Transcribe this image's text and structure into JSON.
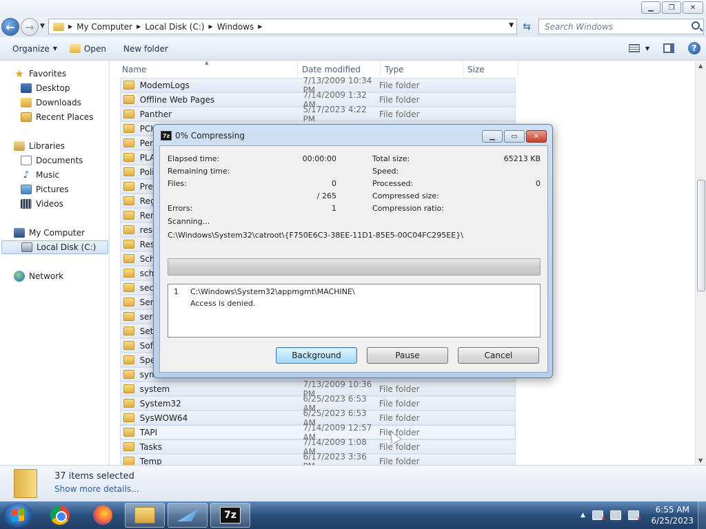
{
  "window": {
    "caption_buttons": [
      "minimize",
      "maximize",
      "close"
    ]
  },
  "address": {
    "crumbs": [
      "My Computer",
      "Local Disk (C:)",
      "Windows"
    ],
    "search_placeholder": "Search Windows"
  },
  "toolbar": {
    "organize": "Organize",
    "open": "Open",
    "new_folder": "New folder"
  },
  "nav": {
    "favorites": "Favorites",
    "desktop": "Desktop",
    "downloads": "Downloads",
    "recent_places": "Recent Places",
    "libraries": "Libraries",
    "documents": "Documents",
    "music": "Music",
    "pictures": "Pictures",
    "videos": "Videos",
    "my_computer": "My Computer",
    "local_disk": "Local Disk (C:)",
    "network": "Network"
  },
  "columns": {
    "name": "Name",
    "date": "Date modified",
    "type": "Type",
    "size": "Size"
  },
  "files": [
    {
      "name": "ModemLogs",
      "date": "7/13/2009 10:34 PM",
      "type": "File folder"
    },
    {
      "name": "Offline Web Pages",
      "date": "7/14/2009 1:32 AM",
      "type": "File folder"
    },
    {
      "name": "Panther",
      "date": "5/17/2023 4:22 PM",
      "type": "File folder"
    },
    {
      "name": "PCH",
      "date": "",
      "type": ""
    },
    {
      "name": "Perfo",
      "date": "",
      "type": ""
    },
    {
      "name": "PLA",
      "date": "",
      "type": ""
    },
    {
      "name": "Polic",
      "date": "",
      "type": ""
    },
    {
      "name": "Prefe",
      "date": "",
      "type": ""
    },
    {
      "name": "Regi",
      "date": "",
      "type": ""
    },
    {
      "name": "Rem",
      "date": "",
      "type": ""
    },
    {
      "name": "resca",
      "date": "",
      "type": ""
    },
    {
      "name": "Reso",
      "date": "",
      "type": ""
    },
    {
      "name": "SchC",
      "date": "",
      "type": ""
    },
    {
      "name": "sche",
      "date": "",
      "type": ""
    },
    {
      "name": "secu",
      "date": "",
      "type": ""
    },
    {
      "name": "Servi",
      "date": "",
      "type": ""
    },
    {
      "name": "servi",
      "date": "",
      "type": ""
    },
    {
      "name": "Setu",
      "date": "",
      "type": ""
    },
    {
      "name": "Softv",
      "date": "",
      "type": ""
    },
    {
      "name": "Spee",
      "date": "",
      "type": ""
    },
    {
      "name": "syml",
      "date": "",
      "type": ""
    },
    {
      "name": "system",
      "date": "7/13/2009 10:36 PM",
      "type": "File folder"
    },
    {
      "name": "System32",
      "date": "6/25/2023 6:53 AM",
      "type": "File folder"
    },
    {
      "name": "SysWOW64",
      "date": "6/25/2023 6:53 AM",
      "type": "File folder"
    },
    {
      "name": "TAPI",
      "date": "7/14/2009 12:57 AM",
      "type": "File folder"
    },
    {
      "name": "Tasks",
      "date": "7/14/2009 1:08 AM",
      "type": "File folder"
    },
    {
      "name": "Temp",
      "date": "6/17/2023 3:36 PM",
      "type": "File folder"
    }
  ],
  "details": {
    "count": "37 items selected",
    "more": "Show more details..."
  },
  "dialog": {
    "title": "0% Compressing",
    "icon_text": "7z",
    "progress": 0,
    "labels": {
      "elapsed": "Elapsed time:",
      "remaining": "Remaining time:",
      "files": "Files:",
      "errors": "Errors:",
      "scanning": "Scanning...",
      "total_size": "Total size:",
      "speed": "Speed:",
      "processed": "Processed:",
      "compressed_size": "Compressed size:",
      "compression_ratio": "Compression ratio:"
    },
    "values": {
      "elapsed": "00:00:00",
      "files": "0",
      "files_total": "/ 265",
      "errors": "1",
      "total_size": "65213 KB",
      "processed": "0"
    },
    "current_path": "C:\\Windows\\System32\\catroot\\{F750E6C3-38EE-11D1-85E5-00C04FC295EE}\\",
    "messages": [
      {
        "num": "1",
        "path": "C:\\Windows\\System32\\appmgmt\\MACHINE\\",
        "error": "Access is denied."
      }
    ],
    "buttons": {
      "background": "Background",
      "pause": "Pause",
      "cancel": "Cancel"
    }
  },
  "taskbar": {
    "time": "6:55 AM",
    "date": "6/25/2023",
    "app_7z": "7z"
  }
}
